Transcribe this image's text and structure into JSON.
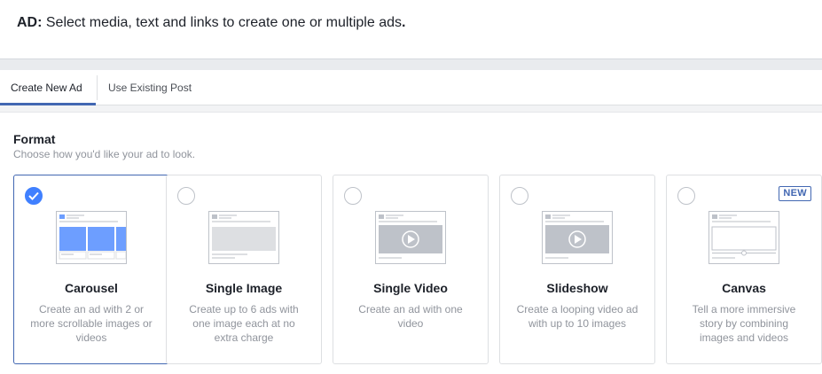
{
  "header": {
    "ad_label": "AD:",
    "instruction": " Select media, text and links to create one or multiple ads",
    "period": "."
  },
  "tabs": [
    {
      "label": "Create New Ad",
      "active": true
    },
    {
      "label": "Use Existing Post",
      "active": false
    }
  ],
  "format": {
    "title": "Format",
    "subtitle": "Choose how you'd like your ad to look."
  },
  "cards": [
    {
      "title": "Carousel",
      "description": "Create an ad with 2 or more scrollable images or videos",
      "selected": true,
      "icon": "carousel-preview-icon"
    },
    {
      "title": "Single Image",
      "description": "Create up to 6 ads with one image each at no extra charge",
      "selected": false,
      "icon": "single-image-preview-icon"
    },
    {
      "title": "Single Video",
      "description": "Create an ad with one video",
      "selected": false,
      "icon": "single-video-preview-icon"
    },
    {
      "title": "Slideshow",
      "description": "Create a looping video ad with up to 10 images",
      "selected": false,
      "icon": "slideshow-preview-icon"
    },
    {
      "title": "Canvas",
      "description": "Tell a more immersive story by combining images and videos",
      "selected": false,
      "badge": "NEW",
      "icon": "canvas-preview-icon"
    }
  ],
  "colors": {
    "accent": "#4267b2",
    "check": "#4080ff",
    "carousel_blue": "#6d9eff",
    "placeholder_gray": "#bec2c9"
  }
}
